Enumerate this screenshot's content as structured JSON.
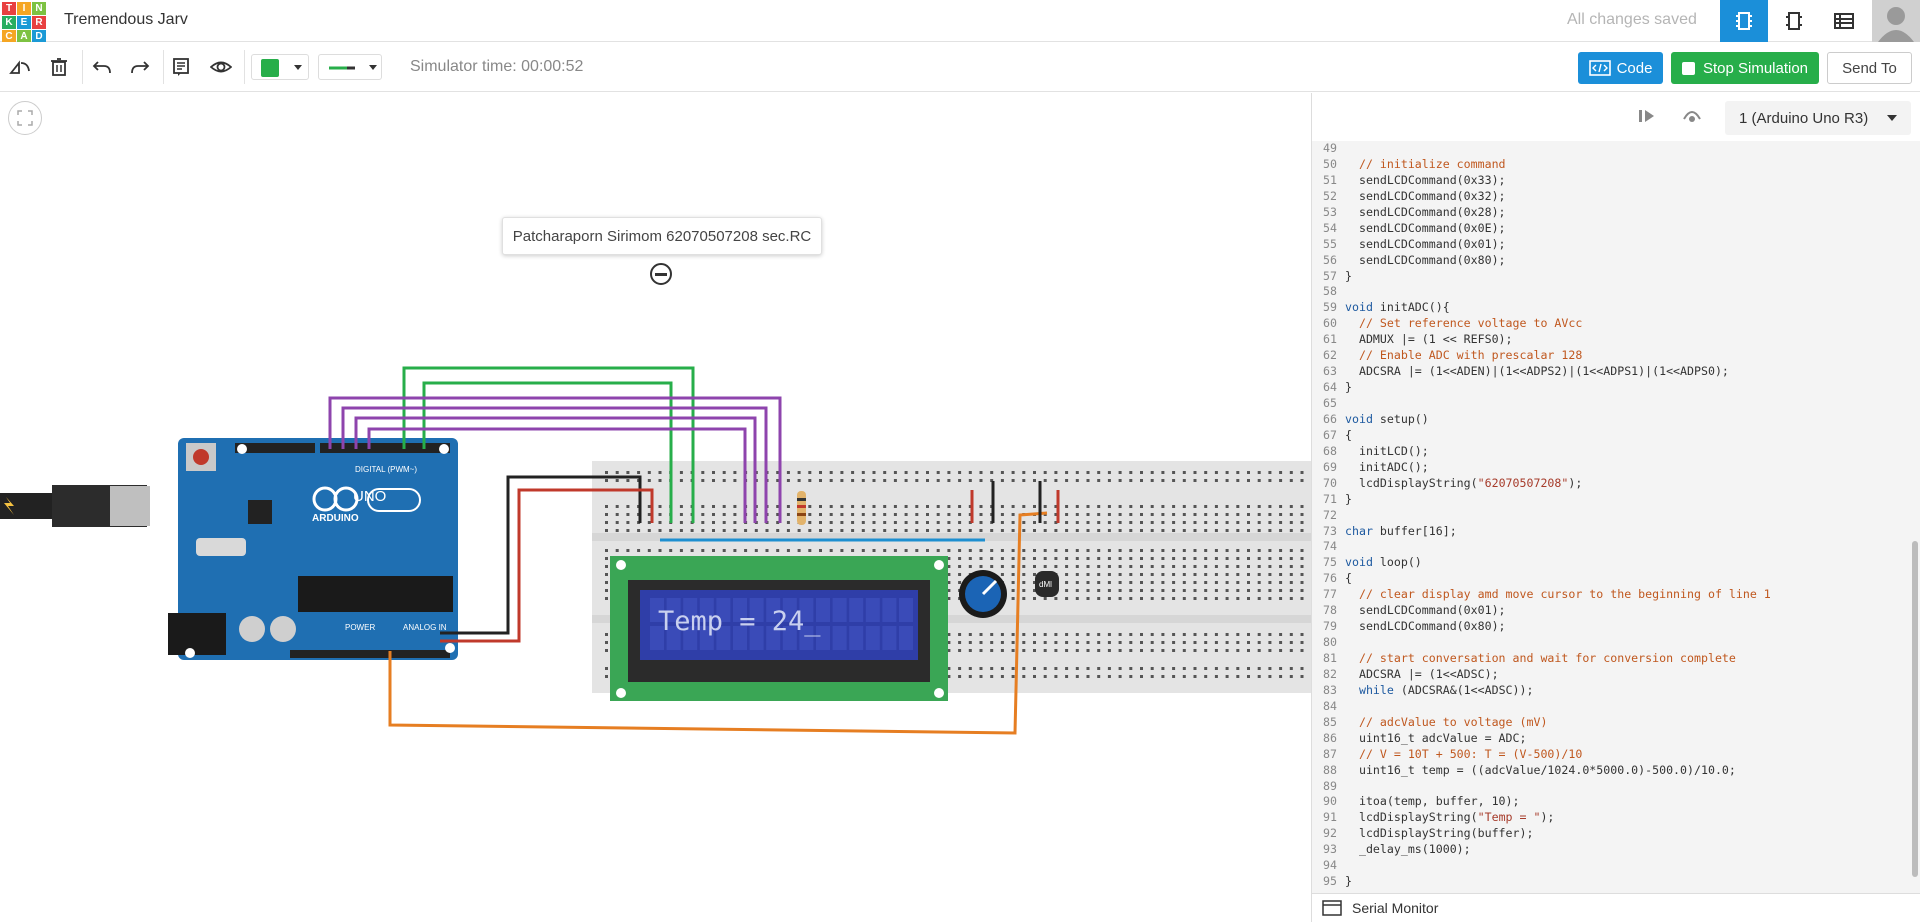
{
  "header": {
    "logo_letters": [
      "T",
      "I",
      "N",
      "K",
      "E",
      "R",
      "C",
      "A",
      "D"
    ],
    "logo_colors": [
      "#e84040",
      "#f5a623",
      "#7dc242",
      "#27ae60",
      "#1b9ad6",
      "#e84040",
      "#f5a623",
      "#7dc242",
      "#1b9ad6"
    ],
    "title": "Tremendous Jarv",
    "status": "All changes saved",
    "views": [
      "circuit-view-icon",
      "schematic-view-icon",
      "component-list-icon"
    ]
  },
  "toolbar": {
    "simulator_time": "Simulator time: 00:00:52",
    "code_label": "Code",
    "stop_label": "Stop Simulation",
    "send_label": "Send To",
    "wire_color": "#27ae4a"
  },
  "canvas": {
    "note_text": "Patcharaporn Sirimom 62070507208 sec.RC",
    "lcd_text": "Temp = 24_",
    "arduino_label": "UNO",
    "arduino_brand": "ARDUINO",
    "header_digital": "DIGITAL (PWM~)",
    "header_power": "POWER",
    "header_analog": "ANALOG IN",
    "sensor_label": "dMl"
  },
  "code_panel": {
    "device": "1 (Arduino Uno R3)",
    "serial_monitor": "Serial Monitor",
    "lines": [
      {
        "n": "49",
        "parts": [
          {
            "t": "",
            "c": "txt"
          }
        ]
      },
      {
        "n": "50",
        "parts": [
          {
            "t": "  // initialize command",
            "c": "cm"
          }
        ]
      },
      {
        "n": "51",
        "parts": [
          {
            "t": "  sendLCDCommand(0x33);",
            "c": "txt"
          }
        ]
      },
      {
        "n": "52",
        "parts": [
          {
            "t": "  sendLCDCommand(0x32);",
            "c": "txt"
          }
        ]
      },
      {
        "n": "53",
        "parts": [
          {
            "t": "  sendLCDCommand(0x28);",
            "c": "txt"
          }
        ]
      },
      {
        "n": "54",
        "parts": [
          {
            "t": "  sendLCDCommand(0x0E);",
            "c": "txt"
          }
        ]
      },
      {
        "n": "55",
        "parts": [
          {
            "t": "  sendLCDCommand(0x01);",
            "c": "txt"
          }
        ]
      },
      {
        "n": "56",
        "parts": [
          {
            "t": "  sendLCDCommand(0x80);",
            "c": "txt"
          }
        ]
      },
      {
        "n": "57",
        "parts": [
          {
            "t": "}",
            "c": "txt"
          }
        ]
      },
      {
        "n": "58",
        "parts": [
          {
            "t": "",
            "c": "txt"
          }
        ]
      },
      {
        "n": "59",
        "parts": [
          {
            "t": "void",
            "c": "kw"
          },
          {
            "t": " initADC(){",
            "c": "txt"
          }
        ]
      },
      {
        "n": "60",
        "parts": [
          {
            "t": "  // Set reference voltage to AVcc",
            "c": "cm"
          }
        ]
      },
      {
        "n": "61",
        "parts": [
          {
            "t": "  ADMUX |= (1 << REFS0);",
            "c": "txt"
          }
        ]
      },
      {
        "n": "62",
        "parts": [
          {
            "t": "  // Enable ADC with prescalar 128",
            "c": "cm"
          }
        ]
      },
      {
        "n": "63",
        "parts": [
          {
            "t": "  ADCSRA |= (1<<ADEN)|(1<<ADPS2)|(1<<ADPS1)|(1<<ADPS0);",
            "c": "txt"
          }
        ]
      },
      {
        "n": "64",
        "parts": [
          {
            "t": "}",
            "c": "txt"
          }
        ]
      },
      {
        "n": "65",
        "parts": [
          {
            "t": "",
            "c": "txt"
          }
        ]
      },
      {
        "n": "66",
        "parts": [
          {
            "t": "void",
            "c": "kw"
          },
          {
            "t": " setup()",
            "c": "txt"
          }
        ]
      },
      {
        "n": "67",
        "parts": [
          {
            "t": "{",
            "c": "txt"
          }
        ]
      },
      {
        "n": "68",
        "parts": [
          {
            "t": "  initLCD();",
            "c": "txt"
          }
        ]
      },
      {
        "n": "69",
        "parts": [
          {
            "t": "  initADC();",
            "c": "txt"
          }
        ]
      },
      {
        "n": "70",
        "parts": [
          {
            "t": "  lcdDisplayString(",
            "c": "txt"
          },
          {
            "t": "\"62070507208\"",
            "c": "st"
          },
          {
            "t": ");",
            "c": "txt"
          }
        ]
      },
      {
        "n": "71",
        "parts": [
          {
            "t": "}",
            "c": "txt"
          }
        ]
      },
      {
        "n": "72",
        "parts": [
          {
            "t": "",
            "c": "txt"
          }
        ]
      },
      {
        "n": "73",
        "parts": [
          {
            "t": "char",
            "c": "kw"
          },
          {
            "t": " buffer[16];",
            "c": "txt"
          }
        ]
      },
      {
        "n": "74",
        "parts": [
          {
            "t": "",
            "c": "txt"
          }
        ]
      },
      {
        "n": "75",
        "parts": [
          {
            "t": "void",
            "c": "kw"
          },
          {
            "t": " loop()",
            "c": "txt"
          }
        ]
      },
      {
        "n": "76",
        "parts": [
          {
            "t": "{",
            "c": "txt"
          }
        ]
      },
      {
        "n": "77",
        "parts": [
          {
            "t": "  // clear display amd move cursor to the beginning of line 1",
            "c": "cm"
          }
        ]
      },
      {
        "n": "78",
        "parts": [
          {
            "t": "  sendLCDCommand(0x01);",
            "c": "txt"
          }
        ]
      },
      {
        "n": "79",
        "parts": [
          {
            "t": "  sendLCDCommand(0x80);",
            "c": "txt"
          }
        ]
      },
      {
        "n": "80",
        "parts": [
          {
            "t": "",
            "c": "txt"
          }
        ]
      },
      {
        "n": "81",
        "parts": [
          {
            "t": "  // start conversation and wait for conversion complete",
            "c": "cm"
          }
        ]
      },
      {
        "n": "82",
        "parts": [
          {
            "t": "  ADCSRA |= (1<<ADSC);",
            "c": "txt"
          }
        ]
      },
      {
        "n": "83",
        "parts": [
          {
            "t": "  ",
            "c": "txt"
          },
          {
            "t": "while",
            "c": "kw"
          },
          {
            "t": " (ADCSRA&(1<<ADSC));",
            "c": "txt"
          }
        ]
      },
      {
        "n": "84",
        "parts": [
          {
            "t": "",
            "c": "txt"
          }
        ]
      },
      {
        "n": "85",
        "parts": [
          {
            "t": "  // adcValue to voltage (mV)",
            "c": "cm"
          }
        ]
      },
      {
        "n": "86",
        "parts": [
          {
            "t": "  uint16_t adcValue = ADC;",
            "c": "txt"
          }
        ]
      },
      {
        "n": "87",
        "parts": [
          {
            "t": "  // V = 10T + 500: T = (V-500)/10",
            "c": "cm"
          }
        ]
      },
      {
        "n": "88",
        "parts": [
          {
            "t": "  uint16_t temp = ((adcValue/1024.0*5000.0)-500.0)/10.0;",
            "c": "txt"
          }
        ]
      },
      {
        "n": "89",
        "parts": [
          {
            "t": "",
            "c": "txt"
          }
        ]
      },
      {
        "n": "90",
        "parts": [
          {
            "t": "  itoa(temp, buffer, 10);",
            "c": "txt"
          }
        ]
      },
      {
        "n": "91",
        "parts": [
          {
            "t": "  lcdDisplayString(",
            "c": "txt"
          },
          {
            "t": "\"Temp = \"",
            "c": "st"
          },
          {
            "t": ");",
            "c": "txt"
          }
        ]
      },
      {
        "n": "92",
        "parts": [
          {
            "t": "  lcdDisplayString(buffer);",
            "c": "txt"
          }
        ]
      },
      {
        "n": "93",
        "parts": [
          {
            "t": "  _delay_ms(1000);",
            "c": "txt"
          }
        ]
      },
      {
        "n": "94",
        "parts": [
          {
            "t": "",
            "c": "txt"
          }
        ]
      },
      {
        "n": "95",
        "parts": [
          {
            "t": "}",
            "c": "txt"
          }
        ]
      }
    ]
  }
}
